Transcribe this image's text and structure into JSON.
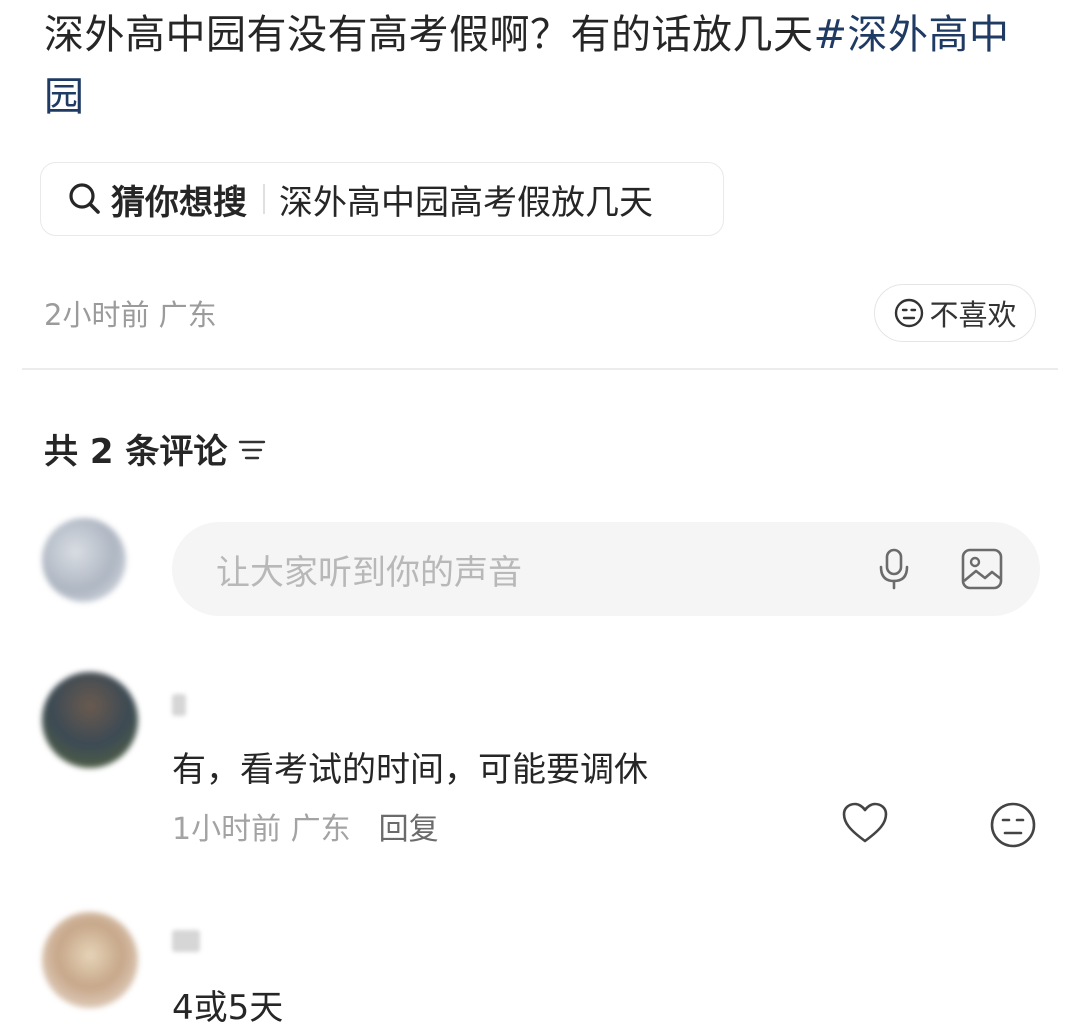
{
  "post": {
    "title": "深外高中园有没有高考假啊？有的话放几天",
    "tag": "#深外高中园",
    "guess": {
      "label": "猜你想搜",
      "query": "深外高中园高考假放几天"
    },
    "meta": "2小时前 广东",
    "dislike_label": "不喜欢"
  },
  "comments_section": {
    "header": "共 2 条评论",
    "input_placeholder": "让大家听到你的声音",
    "items": [
      {
        "text": "有，看考试的时间，可能要调休",
        "meta": "1小时前 广东",
        "reply_label": "回复"
      },
      {
        "text": "4或5天"
      }
    ]
  },
  "icons": {
    "search": "search-icon",
    "dislike": "neutral-face-icon",
    "sort": "sort-icon",
    "mic": "microphone-icon",
    "image": "image-icon",
    "like": "heart-icon"
  },
  "colors": {
    "tag": "#1f3b63",
    "muted": "#9b9b9b",
    "input_bg": "#f5f5f5"
  }
}
